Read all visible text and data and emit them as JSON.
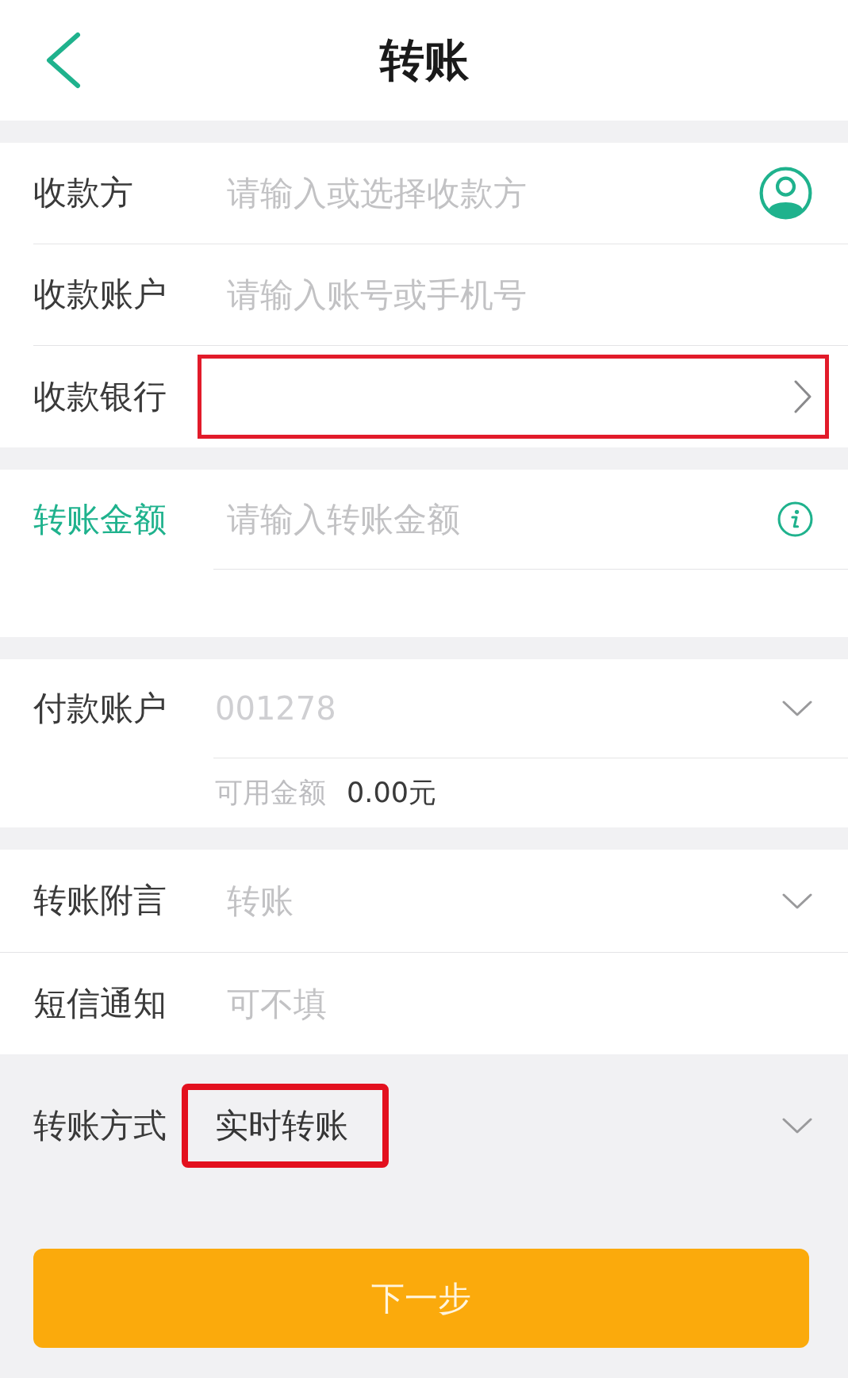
{
  "header": {
    "title": "转账"
  },
  "sections": [
    {
      "rows": [
        {
          "kind": "payee",
          "label": "收款方",
          "placeholder": "请输入或选择收款方",
          "focused": false
        },
        {
          "kind": "input",
          "label": "收款账户",
          "placeholder": "请输入账号或手机号",
          "focused": false
        },
        {
          "kind": "picker",
          "label": "收款银行",
          "focused": false,
          "highlighted": true
        }
      ]
    },
    {
      "rows": [
        {
          "kind": "amount",
          "label": "转账金额",
          "placeholder": "请输入转账金额",
          "focused": true
        }
      ]
    },
    {
      "rows": [
        {
          "kind": "account",
          "label": "付款账户",
          "value": "001278",
          "balance_label": "可用金额",
          "balance": "0.00元",
          "focused": false
        }
      ]
    },
    {
      "rows": [
        {
          "kind": "dropdown",
          "label": "转账附言",
          "placeholder": "转账",
          "focused": false
        },
        {
          "kind": "input",
          "label": "短信通知",
          "placeholder": "可不填",
          "focused": false
        }
      ]
    }
  ],
  "transfer_method": {
    "label": "转账方式",
    "value": "实时转账",
    "highlighted": true
  },
  "next_button": {
    "label": "下一步"
  }
}
